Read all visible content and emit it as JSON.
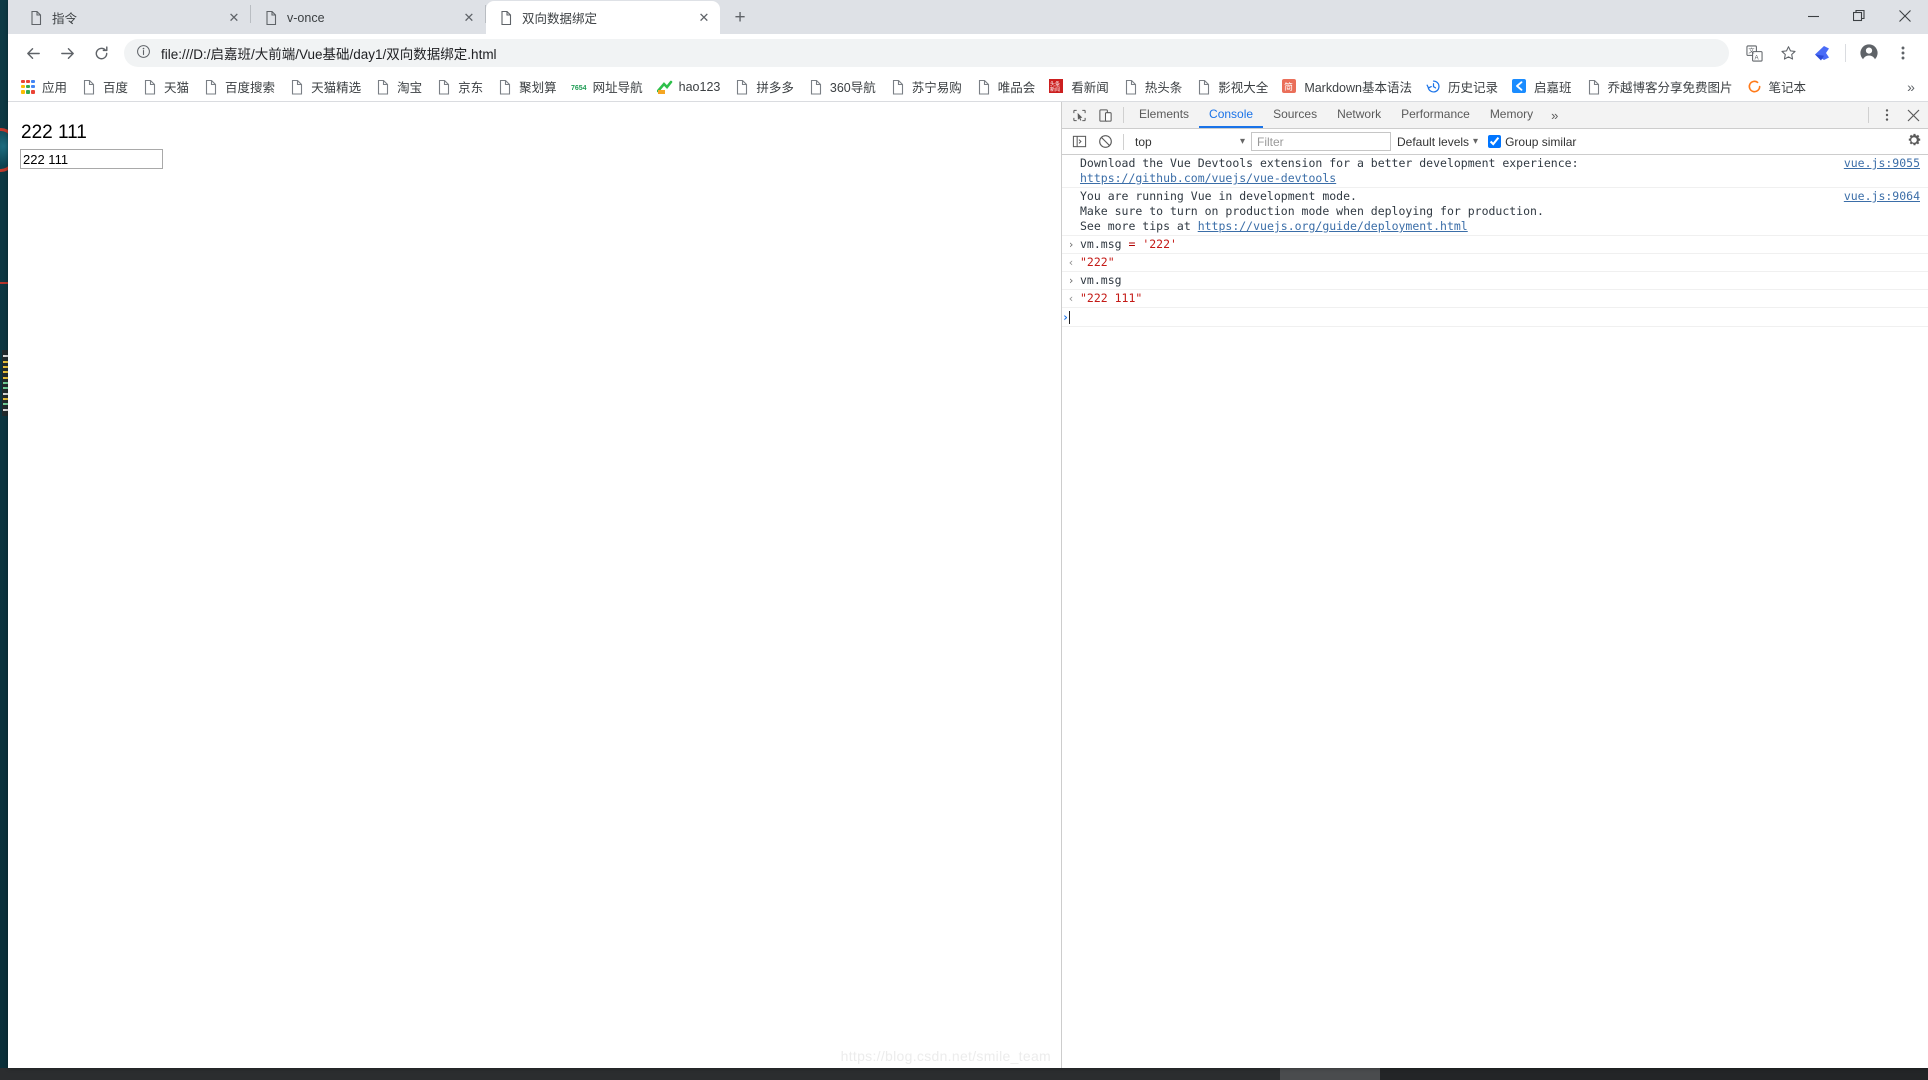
{
  "window": {
    "controls": {
      "minimize": "—",
      "maximize": "▢",
      "close": "✕"
    }
  },
  "tabs": [
    {
      "title": "指令",
      "icon": "page-icon",
      "close": "✕",
      "active": false
    },
    {
      "title": "v-once",
      "icon": "page-icon",
      "close": "✕",
      "active": false
    },
    {
      "title": "双向数据绑定",
      "icon": "page-icon",
      "close": "✕",
      "active": true
    }
  ],
  "new_tab_label": "+",
  "toolbar": {
    "back": "←",
    "forward": "→",
    "reload": "⟳",
    "info_icon": "ⓘ",
    "url": "file:///D:/启嘉班/大前端/Vue基础/day1/双向数据绑定.html",
    "translate_icon": "translate-icon",
    "bookmark_star": "☆",
    "extension_icon": "extension-icon",
    "profile_icon": "profile-icon",
    "menu_icon": "⋮"
  },
  "bookmarks": {
    "overflow": "»",
    "items": [
      {
        "label": "应用",
        "icon": "apps-grid"
      },
      {
        "label": "百度",
        "icon": "page-icon"
      },
      {
        "label": "天猫",
        "icon": "page-icon"
      },
      {
        "label": "百度搜索",
        "icon": "page-icon"
      },
      {
        "label": "天猫精选",
        "icon": "page-icon"
      },
      {
        "label": "淘宝",
        "icon": "page-icon"
      },
      {
        "label": "京东",
        "icon": "page-icon"
      },
      {
        "label": "聚划算",
        "icon": "page-icon"
      },
      {
        "label": "网址导航",
        "icon": "hao-7654-icon"
      },
      {
        "label": "hao123",
        "icon": "hao123-icon"
      },
      {
        "label": "拼多多",
        "icon": "page-icon"
      },
      {
        "label": "360导航",
        "icon": "page-icon"
      },
      {
        "label": "苏宁易购",
        "icon": "page-icon"
      },
      {
        "label": "唯品会",
        "icon": "page-icon"
      },
      {
        "label": "看新闻",
        "icon": "news-icon"
      },
      {
        "label": "热头条",
        "icon": "page-icon"
      },
      {
        "label": "影视大全",
        "icon": "page-icon"
      },
      {
        "label": "Markdown基本语法",
        "icon": "jian-icon"
      },
      {
        "label": "历史记录",
        "icon": "history-icon"
      },
      {
        "label": "启嘉班",
        "icon": "qijiaban-icon"
      },
      {
        "label": "乔越博客分享免费图片",
        "icon": "page-icon"
      },
      {
        "label": "笔记本",
        "icon": "notebook-icon"
      }
    ]
  },
  "page": {
    "heading": "222 111",
    "input_value": "222 111",
    "watermark": "https://blog.csdn.net/smile_team"
  },
  "devtools": {
    "inspect_icon": "inspect-cursor-icon",
    "device_icon": "device-toggle-icon",
    "tabs": [
      {
        "label": "Elements",
        "active": false
      },
      {
        "label": "Console",
        "active": true
      },
      {
        "label": "Sources",
        "active": false
      },
      {
        "label": "Network",
        "active": false
      },
      {
        "label": "Performance",
        "active": false
      },
      {
        "label": "Memory",
        "active": false
      }
    ],
    "more_tabs": "»",
    "menu_icon": "⋮",
    "close_icon": "✕",
    "toolbar": {
      "sidebar_icon": "console-sidebar-icon",
      "clear_icon": "clear-console-icon",
      "context": "top",
      "context_caret": "▾",
      "filter_placeholder": "Filter",
      "levels_label": "Default levels",
      "levels_caret": "▾",
      "group_similar_label": "Group similar",
      "group_similar_checked": true,
      "settings_icon": "gear-icon"
    },
    "console": {
      "messages": [
        {
          "type": "info",
          "lines": [
            {
              "text": "Download the Vue Devtools extension for a better development experience: "
            },
            {
              "link": "https://github.com/vuejs/vue-devtools"
            }
          ],
          "source": "vue.js:9055"
        },
        {
          "type": "info",
          "lines": [
            {
              "text": "You are running Vue in development mode."
            },
            {
              "text": "Make sure to turn on production mode when deploying for production."
            },
            {
              "text": "See more tips at ",
              "link": "https://vuejs.org/guide/deployment.html"
            }
          ],
          "source": "vue.js:9064"
        },
        {
          "type": "input",
          "gutter": "›",
          "code_plain": "vm.msg ",
          "code_op": "= ",
          "code_str": "'222'"
        },
        {
          "type": "output",
          "gutter": "‹",
          "result": "\"222\""
        },
        {
          "type": "input",
          "gutter": "›",
          "code_plain": "vm.msg",
          "code_op": "",
          "code_str": ""
        },
        {
          "type": "output",
          "gutter": "‹",
          "result": "\"222 111\""
        }
      ],
      "prompt": "›"
    }
  },
  "colors": {
    "accent": "#1a73e8",
    "tabstrip_bg": "#dee1e6",
    "omnibox_bg": "#f1f3f4",
    "console_string": "#c41a16",
    "link": "#3b6ea8",
    "desktop": "#0d3640"
  }
}
